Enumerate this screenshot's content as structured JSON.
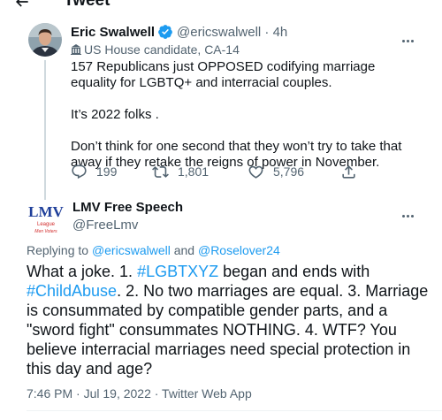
{
  "header": {
    "title": "Tweet"
  },
  "parent_tweet": {
    "author_name": "Eric Swalwell",
    "handle": "@ericswalwell",
    "time": "4h",
    "label": "US House candidate, CA-14",
    "paragraphs": [
      "157 Republicans just OPPOSED codifying marriage equality for LGBTQ+ and interracial couples.",
      "It’s 2022 folks .",
      "Don’t think for one second that they won’t try to take that away if they retake the reigns of power in November."
    ],
    "replies": "199",
    "retweets": "1,801",
    "likes": "5,796"
  },
  "reply_tweet": {
    "author_name": "LMV Free Speech",
    "handle": "@FreeLmv",
    "avatar_text": "LMV",
    "avatar_sub1": "League",
    "avatar_sub2": "Men Voters",
    "replying_prefix": "Replying to",
    "replying_to_1": "@ericswalwell",
    "replying_and": "and",
    "replying_to_2": "@Roselover24",
    "text_1": "What a joke.  1. ",
    "tag_1": "#LGBTXYZ",
    "text_2": " began and ends with ",
    "tag_2": "#ChildAbuse",
    "text_3": ". 2. No two marriages are equal.  3. Marriage is consummated by compatible gender parts, and a \"sword fight\" consummates NOTHING.  4. WTF?  You believe interracial marriages need special protection in this day and age?",
    "timestamp": "7:46 PM · Jul 19, 2022 · Twitter Web App"
  },
  "colors": {
    "accent": "#1d9bf0",
    "secondary_text": "#536471",
    "text": "#0f1419",
    "lmv_blue": "#1f3f9a",
    "lmv_red": "#d22b2b"
  },
  "icons": [
    "back-arrow-icon",
    "verified-badge-icon",
    "building-icon",
    "more-icon",
    "reply-icon",
    "retweet-icon",
    "like-icon",
    "share-icon"
  ]
}
